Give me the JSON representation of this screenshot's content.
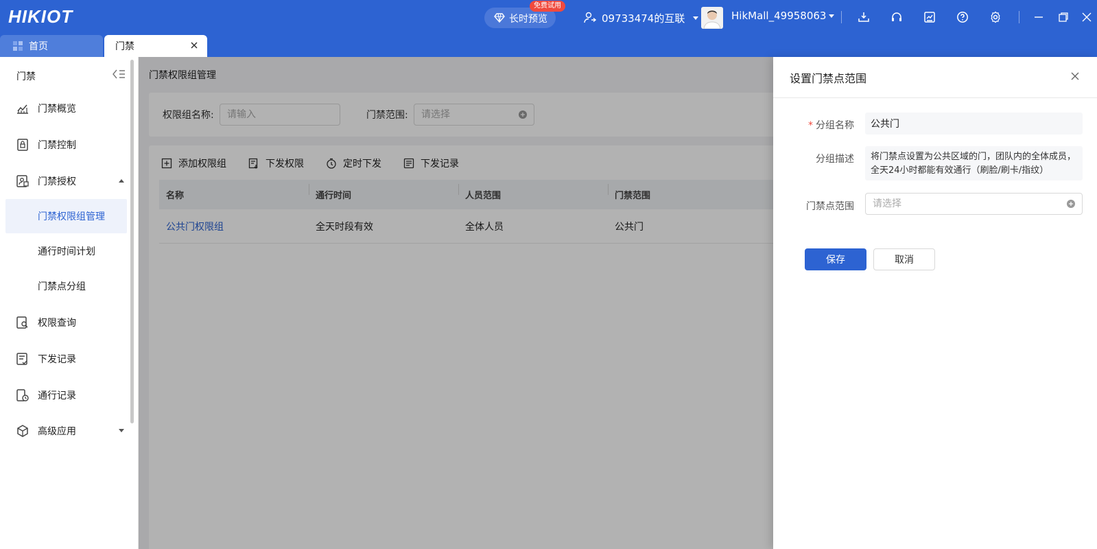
{
  "header": {
    "logo": "HIKIOT",
    "trial_label": "长时预览",
    "trial_badge": "免费试用",
    "org_name": "09733474的互联",
    "user_name": "HikMall_49958063"
  },
  "tabs": [
    {
      "label": "首页"
    },
    {
      "label": "门禁"
    }
  ],
  "sidebar": {
    "title": "门禁",
    "items": [
      {
        "label": "门禁概览"
      },
      {
        "label": "门禁控制"
      },
      {
        "label": "门禁授权"
      },
      {
        "label": "门禁权限组管理"
      },
      {
        "label": "通行时间计划"
      },
      {
        "label": "门禁点分组"
      },
      {
        "label": "权限查询"
      },
      {
        "label": "下发记录"
      },
      {
        "label": "通行记录"
      },
      {
        "label": "高级应用"
      }
    ]
  },
  "main": {
    "breadcrumb": "门禁权限组管理",
    "filters": {
      "group_name_label": "权限组名称:",
      "group_name_placeholder": "请输入",
      "scope_label": "门禁范围:",
      "scope_placeholder": "请选择"
    },
    "toolbar": {
      "add": "添加权限组",
      "issue": "下发权限",
      "scheduled": "定时下发",
      "records": "下发记录"
    },
    "table": {
      "headers": [
        "名称",
        "通行时间",
        "人员范围",
        "门禁范围"
      ],
      "rows": [
        [
          "公共门权限组",
          "全天时段有效",
          "全体人员",
          "公共门"
        ]
      ]
    }
  },
  "drawer": {
    "title": "设置门禁点范围",
    "name_label": "分组名称",
    "name_value": "公共门",
    "desc_label": "分组描述",
    "desc_value": "将门禁点设置为公共区域的门，团队内的全体成员，全天24小时都能有效通行（刷脸/刷卡/指纹）",
    "scope_label": "门禁点范围",
    "scope_placeholder": "请选择",
    "save": "保存",
    "cancel": "取消"
  },
  "colors": {
    "brand": "#2d63d2",
    "badge": "#f04a3e"
  }
}
